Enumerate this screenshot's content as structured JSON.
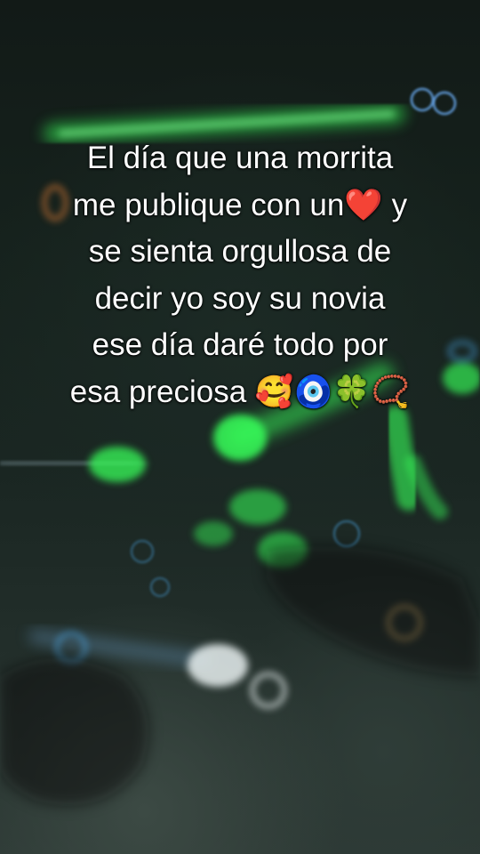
{
  "overlay": {
    "lines": [
      "El día que una morrita",
      "me publique con un❤️ y",
      "se sienta orgullosa de",
      "decir yo soy su novia",
      "ese día daré todo por",
      "esa preciosa 🥰🧿🍀📿"
    ]
  },
  "colors": {
    "text": "#ffffff",
    "neon_green": "#39ff5a",
    "neon_blue": "#4fb6ff",
    "bokeh_white": "#e8f0f0",
    "bokeh_gold": "#d9b46a",
    "background_dark": "#121a17"
  }
}
